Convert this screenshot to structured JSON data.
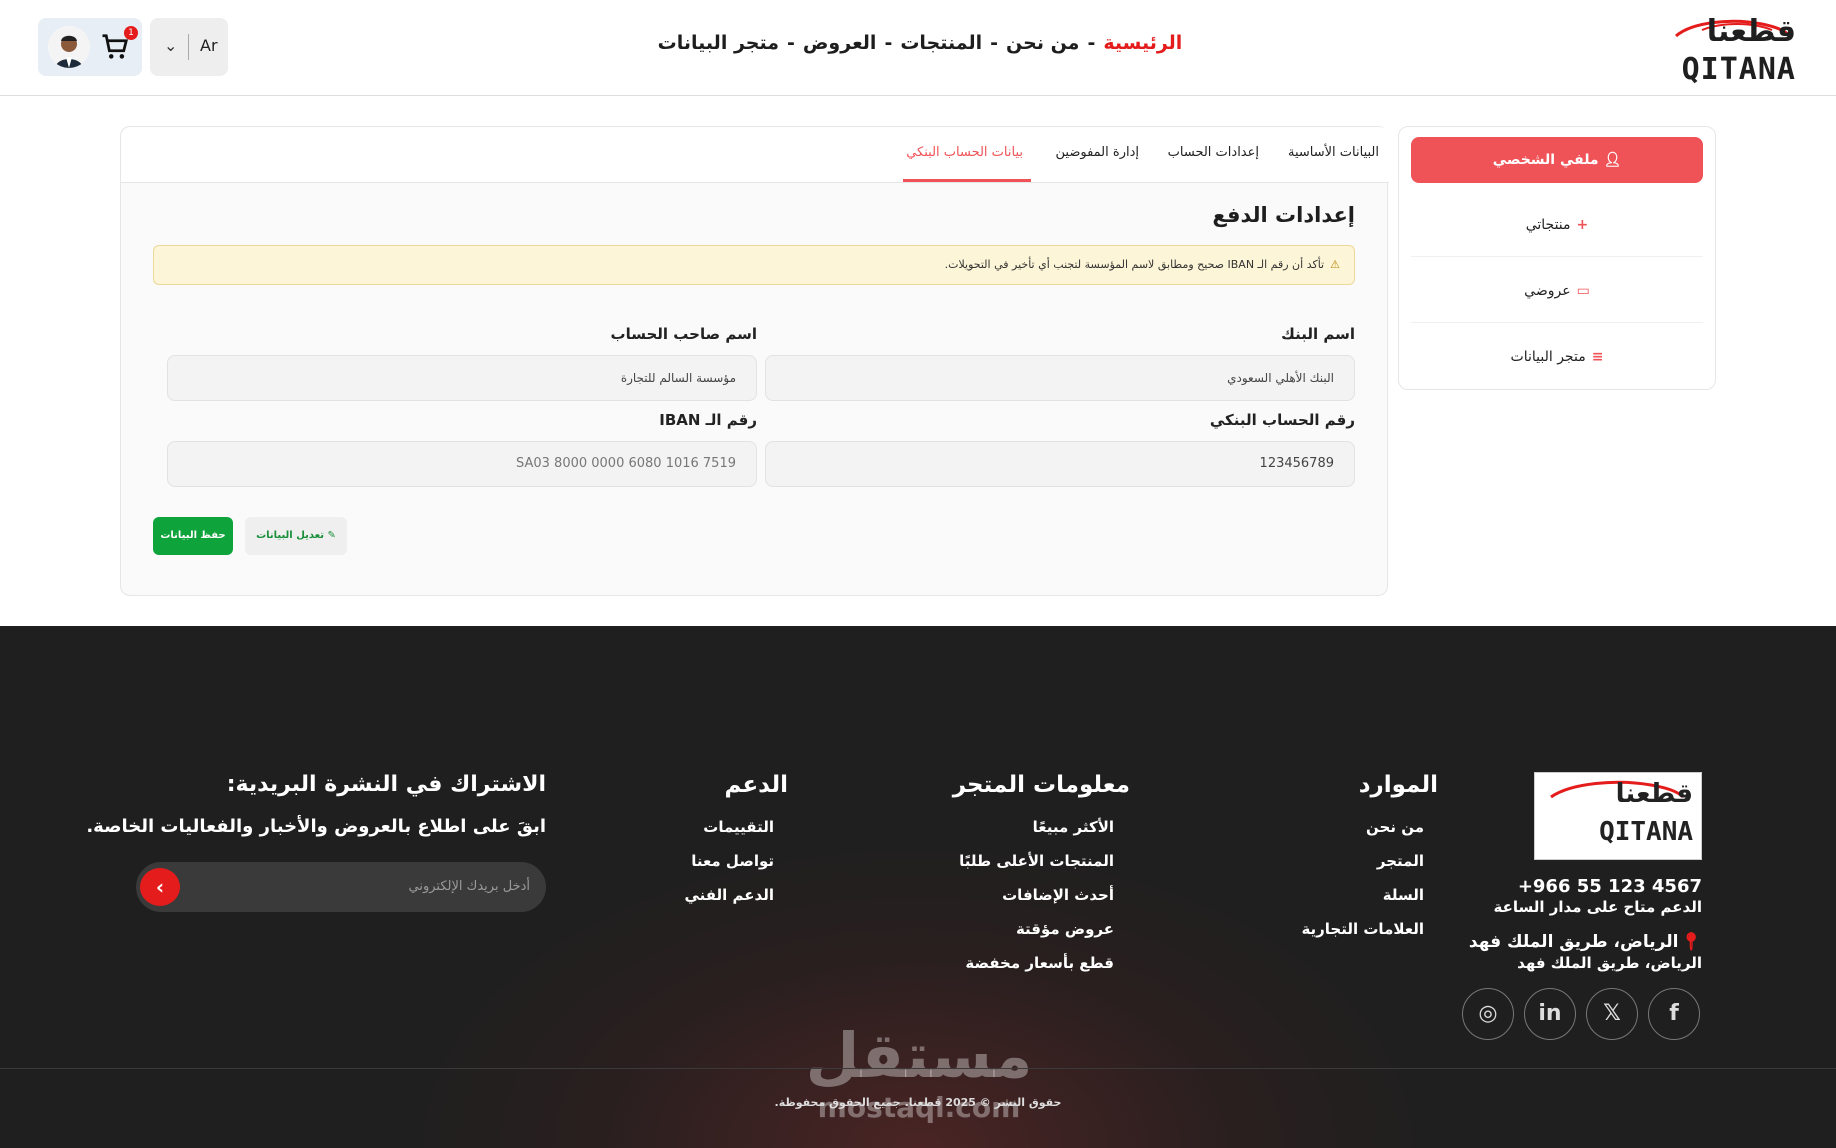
{
  "header": {
    "logo_ar": "قطعنا",
    "logo_en": "QITANA",
    "nav": [
      {
        "label": "الرئيسية",
        "active": true
      },
      {
        "label": "من نحن",
        "active": false
      },
      {
        "label": "المنتجات",
        "active": false
      },
      {
        "label": "العروض",
        "active": false
      },
      {
        "label": "متجر البيانات",
        "active": false
      }
    ],
    "nav_separator": "-",
    "language": "Ar",
    "cart_count": "1"
  },
  "sidebar": {
    "active_label": "ملفي الشخصي",
    "items": [
      {
        "label": "منتجاتي",
        "icon": "+"
      },
      {
        "label": "عروضي",
        "icon": "▭"
      },
      {
        "label": "متجر البيانات",
        "icon": "≡"
      }
    ]
  },
  "tabs": [
    {
      "label": "البيانات الأساسية",
      "active": false
    },
    {
      "label": "إعدادات الحساب",
      "active": false
    },
    {
      "label": "إدارة المفوضين",
      "active": false
    },
    {
      "label": "بيانات الحساب البنكي",
      "active": true
    }
  ],
  "payment": {
    "title": "إعدادات الدفع",
    "alert": "تأكد أن رقم الـ IBAN صحيح ومطابق لاسم المؤسسة لتجنب أي تأخير في التحويلات.",
    "fields": {
      "bank_name": {
        "label": "اسم البنك",
        "value": "البنك الأهلي السعودي"
      },
      "holder_name": {
        "label": "اسم صاحب الحساب",
        "value": "مؤسسة السالم للتجارة"
      },
      "account_number": {
        "label": "رقم الحساب البنكي",
        "value": "123456789"
      },
      "iban": {
        "label": "رقم الـ IBAN",
        "value": "SA03 8000 0000 6080 1016 7519"
      }
    },
    "save_label": "حفظ البيانات",
    "edit_label": "تعديل البيانات"
  },
  "footer": {
    "phone": "+966 55 123 4567",
    "support": "الدعم متاح على مدار الساعة",
    "address_line1": "الرياض، طريق الملك فهد",
    "address_line2": "الرياض، طريق الملك فهد",
    "columns": [
      {
        "title": "الموارد",
        "links": [
          "من نحن",
          "المتجر",
          "السلة",
          "العلامات التجارية"
        ]
      },
      {
        "title": "معلومات المتجر",
        "links": [
          "الأكثر مبيعًا",
          "المنتجات الأعلى طلبًا",
          "أحدث الإضافات",
          "عروض مؤقتة",
          "قطع بأسعار مخفضة"
        ]
      },
      {
        "title": "الدعم",
        "links": [
          "التقييمات",
          "تواصل معنا",
          "الدعم الفني"
        ]
      }
    ],
    "newsletter_title": "الاشتراك في النشرة البريدية:",
    "newsletter_sub": "ابقَ على اطلاع بالعروض والأخبار والفعاليات الخاصة.",
    "newsletter_placeholder": "أدخل بريدك الإلكتروني",
    "copyright": "حقوق النشر © 2025 قطعنا. جميع الحقوق محفوظة.",
    "watermark_ar": "مستقل",
    "watermark_en": "mostaql.com"
  },
  "colors": {
    "accent": "#ef5358",
    "brand_red": "#e41c1c",
    "save_green": "#0fa33b",
    "footer_bg": "#1f1f1f"
  }
}
